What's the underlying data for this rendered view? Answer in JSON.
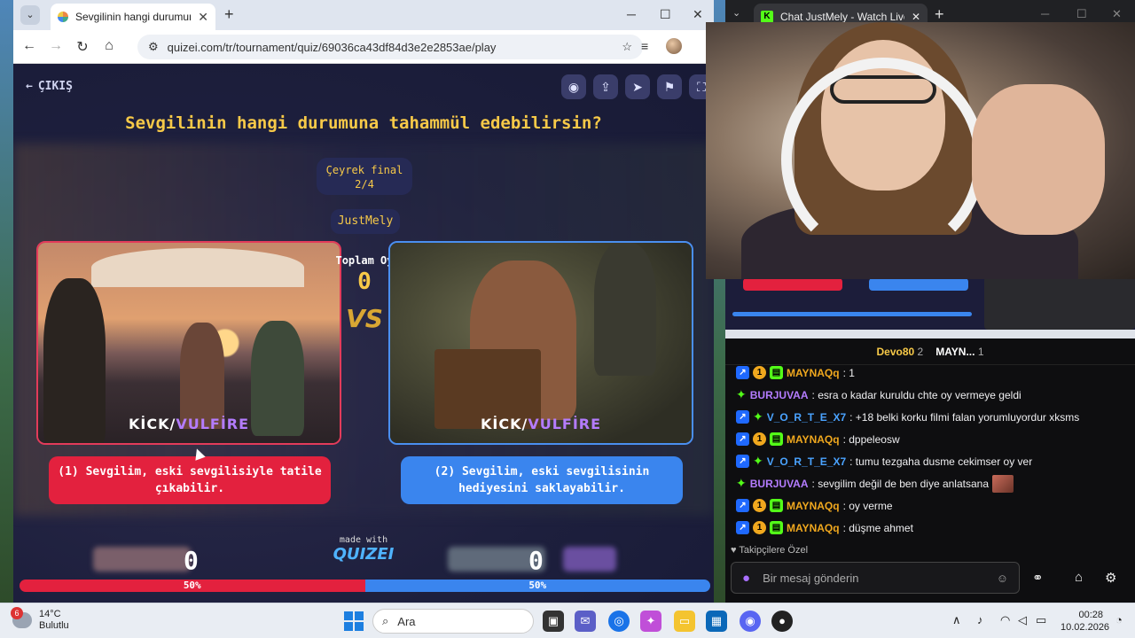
{
  "left_browser": {
    "tab_title": "Sevgilinin hangi durumuna taha",
    "url": "quizei.com/tr/tournament/quiz/69036ca43df84d3e2e2853ae/play"
  },
  "quiz": {
    "exit_label": "ÇIKIŞ",
    "title": "Sevgilinin hangi durumuna tahammül edebilirsin?",
    "round_name": "Çeyrek final",
    "round_progress": "2/4",
    "streamer": "JustMely",
    "total_votes_label": "Toplam Oy",
    "total_votes": "0",
    "vs": "VS",
    "watermark_prefix": "KİCK/",
    "watermark_suffix": "VULFİRE",
    "option_left": "(1) Sevgilim, eski sevgilisiyle tatile çıkabilir.",
    "option_right": "(2) Sevgilim, eski sevgilisinin hediyesini saklayabilir.",
    "made_with": "made with",
    "brand": "QUIZEI",
    "votes_left": "0",
    "votes_right": "0",
    "pct_left": "50%",
    "pct_right": "50%",
    "share_left": 0.5
  },
  "right_browser": {
    "tab_title": "Chat JustMely - Watch Live on K"
  },
  "ranking": {
    "first_name": "Devo80",
    "first_count": "2",
    "second_name": "MAYN...",
    "second_count": "1"
  },
  "chat": {
    "messages": [
      {
        "user": "MAYNAQq",
        "text": ": 1",
        "color": "#f0a81e"
      },
      {
        "user": "BURJUVAA",
        "text": ": esra o kadar kuruldu chte oy vermeye geldi",
        "color": "#b47cff"
      },
      {
        "user": "V_O_R_T_E_X7",
        "text": ": +18 belki korku filmi falan yorumluyordur xksms",
        "color": "#4aa3ff"
      },
      {
        "user": "MAYNAQq",
        "text": ": dppeleosw",
        "color": "#f0a81e"
      },
      {
        "user": "V_O_R_T_E_X7",
        "text": ": tumu tezgaha dusme cekimser oy ver",
        "color": "#4aa3ff"
      },
      {
        "user": "BURJUVAA",
        "text": ": sevgilim değil de ben diye anlatsana",
        "color": "#b47cff"
      },
      {
        "user": "MAYNAQq",
        "text": ": oy verme",
        "color": "#f0a81e"
      },
      {
        "user": "MAYNAQq",
        "text": ": düşme ahmet",
        "color": "#f0a81e"
      }
    ],
    "followers_only": "Takipçilere Özel",
    "input_placeholder": "Bir mesaj gönderin"
  },
  "taskbar": {
    "temperature": "14°C",
    "weather": "Bulutlu",
    "weather_badge": "6",
    "search": "Ara",
    "time": "00:28",
    "date": "10.02.2026"
  }
}
